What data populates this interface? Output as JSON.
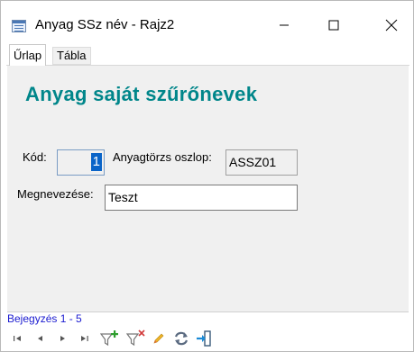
{
  "window": {
    "title": "Anyag SSz név - Rajz2"
  },
  "tabs": [
    {
      "label": "Űrlap",
      "active": true
    },
    {
      "label": "Tábla",
      "active": false
    }
  ],
  "form": {
    "title": "Anyag saját szűrőnevek",
    "kod_label": "Kód:",
    "kod_value": "1",
    "oszlop_label": "Anyagtörzs oszlop:",
    "oszlop_value": "ASSZ01",
    "megnevezes_label": "Megnevezése:",
    "megnevezes_value": "Teszt"
  },
  "status": {
    "record_text": "Bejegyzés 1 - 5"
  },
  "navigator": {
    "buttons": [
      "first-icon",
      "prev-icon",
      "next-icon",
      "last-icon",
      "filter-add-icon",
      "filter-remove-icon",
      "edit-icon",
      "refresh-icon",
      "exit-icon"
    ]
  },
  "colors": {
    "title_teal": "#00868a",
    "status_blue": "#1a1ad0",
    "selection_blue": "#0a64c8",
    "panel_bg": "#f0f0f0"
  }
}
